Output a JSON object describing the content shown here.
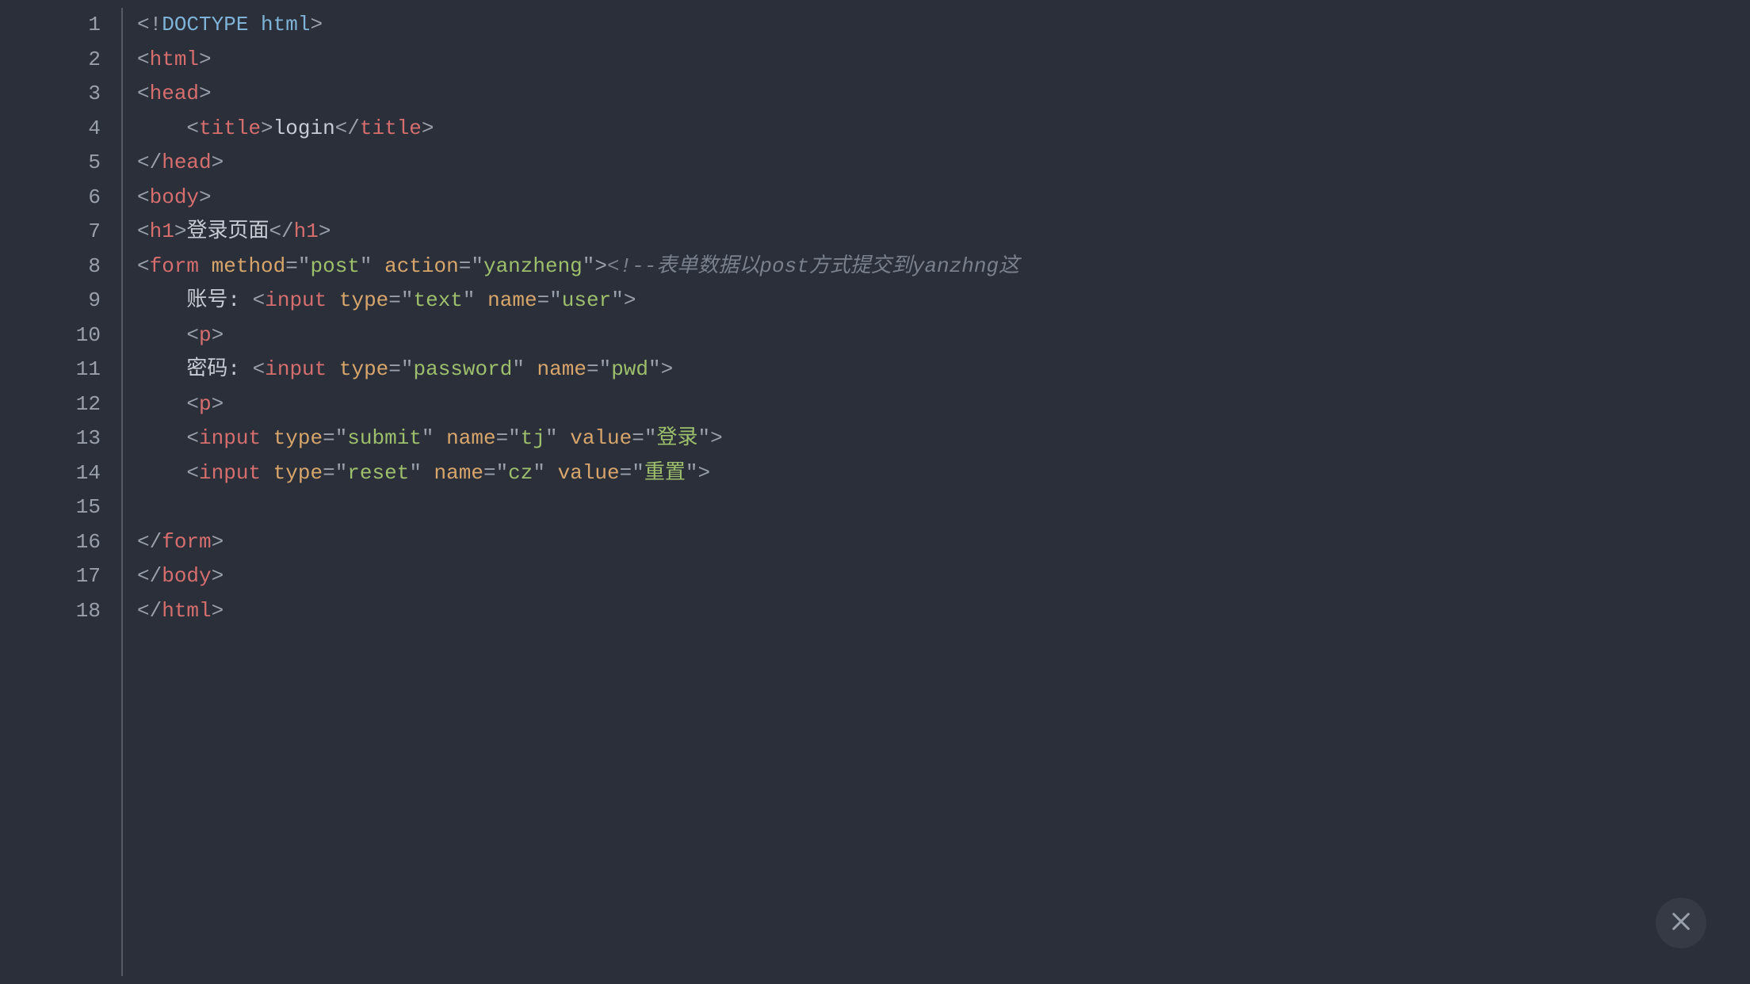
{
  "close_label": "close",
  "lines": [
    {
      "n": "1",
      "tokens": [
        {
          "c": "punct",
          "t": "<!"
        },
        {
          "c": "doctype",
          "t": "DOCTYPE html"
        },
        {
          "c": "punct",
          "t": ">"
        }
      ]
    },
    {
      "n": "2",
      "tokens": [
        {
          "c": "punct",
          "t": "<"
        },
        {
          "c": "tag",
          "t": "html"
        },
        {
          "c": "punct",
          "t": ">"
        }
      ]
    },
    {
      "n": "3",
      "tokens": [
        {
          "c": "punct",
          "t": "<"
        },
        {
          "c": "tag",
          "t": "head"
        },
        {
          "c": "punct",
          "t": ">"
        }
      ]
    },
    {
      "n": "4",
      "tokens": [
        {
          "c": "text",
          "t": "    "
        },
        {
          "c": "punct",
          "t": "<"
        },
        {
          "c": "tag",
          "t": "title"
        },
        {
          "c": "punct",
          "t": ">"
        },
        {
          "c": "text",
          "t": "login"
        },
        {
          "c": "punct",
          "t": "</"
        },
        {
          "c": "tag",
          "t": "title"
        },
        {
          "c": "punct",
          "t": ">"
        }
      ]
    },
    {
      "n": "5",
      "tokens": [
        {
          "c": "punct",
          "t": "</"
        },
        {
          "c": "tag",
          "t": "head"
        },
        {
          "c": "punct",
          "t": ">"
        }
      ]
    },
    {
      "n": "6",
      "tokens": [
        {
          "c": "punct",
          "t": "<"
        },
        {
          "c": "tag",
          "t": "body"
        },
        {
          "c": "punct",
          "t": ">"
        }
      ]
    },
    {
      "n": "7",
      "tokens": [
        {
          "c": "punct",
          "t": "<"
        },
        {
          "c": "tag",
          "t": "h1"
        },
        {
          "c": "punct",
          "t": ">"
        },
        {
          "c": "text",
          "t": "登录页面"
        },
        {
          "c": "punct",
          "t": "</"
        },
        {
          "c": "tag",
          "t": "h1"
        },
        {
          "c": "punct",
          "t": ">"
        }
      ]
    },
    {
      "n": "8",
      "tokens": [
        {
          "c": "punct",
          "t": "<"
        },
        {
          "c": "tag",
          "t": "form"
        },
        {
          "c": "text",
          "t": " "
        },
        {
          "c": "attr",
          "t": "method"
        },
        {
          "c": "punct",
          "t": "="
        },
        {
          "c": "punct",
          "t": "\""
        },
        {
          "c": "string",
          "t": "post"
        },
        {
          "c": "punct",
          "t": "\""
        },
        {
          "c": "text",
          "t": " "
        },
        {
          "c": "attr",
          "t": "action"
        },
        {
          "c": "punct",
          "t": "="
        },
        {
          "c": "punct",
          "t": "\""
        },
        {
          "c": "string",
          "t": "yanzheng"
        },
        {
          "c": "punct",
          "t": "\""
        },
        {
          "c": "punct",
          "t": ">"
        },
        {
          "c": "comment",
          "t": "<!--表单数据以post方式提交到yanzhng这"
        }
      ]
    },
    {
      "n": "9",
      "tokens": [
        {
          "c": "text",
          "t": "    账号: "
        },
        {
          "c": "punct",
          "t": "<"
        },
        {
          "c": "tag",
          "t": "input"
        },
        {
          "c": "text",
          "t": " "
        },
        {
          "c": "attr",
          "t": "type"
        },
        {
          "c": "punct",
          "t": "="
        },
        {
          "c": "punct",
          "t": "\""
        },
        {
          "c": "string",
          "t": "text"
        },
        {
          "c": "punct",
          "t": "\""
        },
        {
          "c": "text",
          "t": " "
        },
        {
          "c": "attr",
          "t": "name"
        },
        {
          "c": "punct",
          "t": "="
        },
        {
          "c": "punct",
          "t": "\""
        },
        {
          "c": "string",
          "t": "user"
        },
        {
          "c": "punct",
          "t": "\""
        },
        {
          "c": "punct",
          "t": ">"
        }
      ]
    },
    {
      "n": "10",
      "tokens": [
        {
          "c": "text",
          "t": "    "
        },
        {
          "c": "punct",
          "t": "<"
        },
        {
          "c": "tag",
          "t": "p"
        },
        {
          "c": "punct",
          "t": ">"
        }
      ]
    },
    {
      "n": "11",
      "tokens": [
        {
          "c": "text",
          "t": "    密码: "
        },
        {
          "c": "punct",
          "t": "<"
        },
        {
          "c": "tag",
          "t": "input"
        },
        {
          "c": "text",
          "t": " "
        },
        {
          "c": "attr",
          "t": "type"
        },
        {
          "c": "punct",
          "t": "="
        },
        {
          "c": "punct",
          "t": "\""
        },
        {
          "c": "string",
          "t": "password"
        },
        {
          "c": "punct",
          "t": "\""
        },
        {
          "c": "text",
          "t": " "
        },
        {
          "c": "attr",
          "t": "name"
        },
        {
          "c": "punct",
          "t": "="
        },
        {
          "c": "punct",
          "t": "\""
        },
        {
          "c": "string",
          "t": "pwd"
        },
        {
          "c": "punct",
          "t": "\""
        },
        {
          "c": "punct",
          "t": ">"
        }
      ]
    },
    {
      "n": "12",
      "tokens": [
        {
          "c": "text",
          "t": "    "
        },
        {
          "c": "punct",
          "t": "<"
        },
        {
          "c": "tag",
          "t": "p"
        },
        {
          "c": "punct",
          "t": ">"
        }
      ]
    },
    {
      "n": "13",
      "tokens": [
        {
          "c": "text",
          "t": "    "
        },
        {
          "c": "punct",
          "t": "<"
        },
        {
          "c": "tag",
          "t": "input"
        },
        {
          "c": "text",
          "t": " "
        },
        {
          "c": "attr",
          "t": "type"
        },
        {
          "c": "punct",
          "t": "="
        },
        {
          "c": "punct",
          "t": "\""
        },
        {
          "c": "string",
          "t": "submit"
        },
        {
          "c": "punct",
          "t": "\""
        },
        {
          "c": "text",
          "t": " "
        },
        {
          "c": "attr",
          "t": "name"
        },
        {
          "c": "punct",
          "t": "="
        },
        {
          "c": "punct",
          "t": "\""
        },
        {
          "c": "string",
          "t": "tj"
        },
        {
          "c": "punct",
          "t": "\""
        },
        {
          "c": "text",
          "t": " "
        },
        {
          "c": "attr",
          "t": "value"
        },
        {
          "c": "punct",
          "t": "="
        },
        {
          "c": "punct",
          "t": "\""
        },
        {
          "c": "string",
          "t": "登录"
        },
        {
          "c": "punct",
          "t": "\""
        },
        {
          "c": "punct",
          "t": ">"
        }
      ]
    },
    {
      "n": "14",
      "tokens": [
        {
          "c": "text",
          "t": "    "
        },
        {
          "c": "punct",
          "t": "<"
        },
        {
          "c": "tag",
          "t": "input"
        },
        {
          "c": "text",
          "t": " "
        },
        {
          "c": "attr",
          "t": "type"
        },
        {
          "c": "punct",
          "t": "="
        },
        {
          "c": "punct",
          "t": "\""
        },
        {
          "c": "string",
          "t": "reset"
        },
        {
          "c": "punct",
          "t": "\""
        },
        {
          "c": "text",
          "t": " "
        },
        {
          "c": "attr",
          "t": "name"
        },
        {
          "c": "punct",
          "t": "="
        },
        {
          "c": "punct",
          "t": "\""
        },
        {
          "c": "string",
          "t": "cz"
        },
        {
          "c": "punct",
          "t": "\""
        },
        {
          "c": "text",
          "t": " "
        },
        {
          "c": "attr",
          "t": "value"
        },
        {
          "c": "punct",
          "t": "="
        },
        {
          "c": "punct",
          "t": "\""
        },
        {
          "c": "string",
          "t": "重置"
        },
        {
          "c": "punct",
          "t": "\""
        },
        {
          "c": "punct",
          "t": ">"
        }
      ]
    },
    {
      "n": "15",
      "tokens": []
    },
    {
      "n": "16",
      "tokens": [
        {
          "c": "punct",
          "t": "</"
        },
        {
          "c": "tag",
          "t": "form"
        },
        {
          "c": "punct",
          "t": ">"
        }
      ]
    },
    {
      "n": "17",
      "tokens": [
        {
          "c": "punct",
          "t": "</"
        },
        {
          "c": "tag",
          "t": "body"
        },
        {
          "c": "punct",
          "t": ">"
        }
      ]
    },
    {
      "n": "18",
      "tokens": [
        {
          "c": "punct",
          "t": "</"
        },
        {
          "c": "tag",
          "t": "html"
        },
        {
          "c": "punct",
          "t": ">"
        }
      ]
    }
  ]
}
